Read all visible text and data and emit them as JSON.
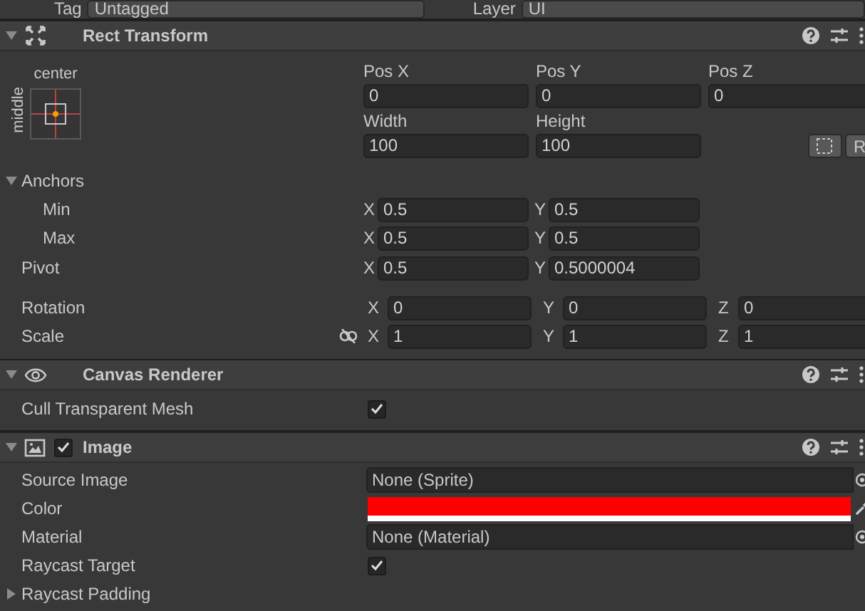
{
  "header_row": {
    "tag_label": "Tag",
    "tag_value": "Untagged",
    "layer_label": "Layer",
    "layer_value": "UI"
  },
  "rect_transform": {
    "title": "Rect Transform",
    "expanded": true,
    "anchor_preset": {
      "horizontal": "center",
      "vertical": "middle"
    },
    "position": [
      {
        "label": "Pos X",
        "value": "0"
      },
      {
        "label": "Pos Y",
        "value": "0"
      },
      {
        "label": "Pos Z",
        "value": "0"
      }
    ],
    "size": [
      {
        "label": "Width",
        "value": "100"
      },
      {
        "label": "Height",
        "value": "100"
      }
    ],
    "raw_button": "R",
    "anchors": {
      "label": "Anchors",
      "expanded": true,
      "rows": [
        {
          "label": "Min",
          "fields": [
            {
              "axis": "X",
              "value": "0.5"
            },
            {
              "axis": "Y",
              "value": "0.5"
            }
          ]
        },
        {
          "label": "Max",
          "fields": [
            {
              "axis": "X",
              "value": "0.5"
            },
            {
              "axis": "Y",
              "value": "0.5"
            }
          ]
        }
      ]
    },
    "pivot": {
      "label": "Pivot",
      "fields": [
        {
          "axis": "X",
          "value": "0.5"
        },
        {
          "axis": "Y",
          "value": "0.5000004"
        }
      ]
    },
    "rotation": {
      "label": "Rotation",
      "fields": [
        {
          "axis": "X",
          "value": "0"
        },
        {
          "axis": "Y",
          "value": "0"
        },
        {
          "axis": "Z",
          "value": "0"
        }
      ]
    },
    "scale": {
      "label": "Scale",
      "constrained": false,
      "fields": [
        {
          "axis": "X",
          "value": "1"
        },
        {
          "axis": "Y",
          "value": "1"
        },
        {
          "axis": "Z",
          "value": "1"
        }
      ]
    }
  },
  "canvas_renderer": {
    "title": "Canvas Renderer",
    "expanded": true,
    "properties": [
      {
        "kind": "checkbox",
        "label": "Cull Transparent Mesh",
        "checked": true
      }
    ]
  },
  "image": {
    "title": "Image",
    "expanded": true,
    "enabled": true,
    "properties": [
      {
        "kind": "object",
        "label": "Source Image",
        "value": "None (Sprite)"
      },
      {
        "kind": "color",
        "label": "Color",
        "color": "#ff0000"
      },
      {
        "kind": "object",
        "label": "Material",
        "value": "None (Material)"
      },
      {
        "kind": "checkbox",
        "label": "Raycast Target",
        "checked": true
      },
      {
        "kind": "foldout",
        "label": "Raycast Padding",
        "expanded": false
      }
    ]
  }
}
